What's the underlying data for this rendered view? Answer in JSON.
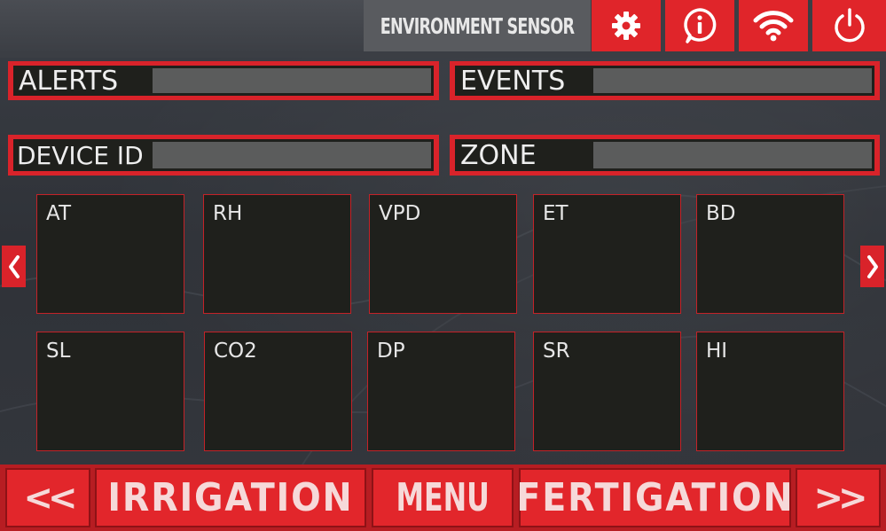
{
  "header": {
    "title": "ENVIRONMENT SENSOR",
    "buttons": [
      {
        "name": "settings",
        "icon": "gear-icon"
      },
      {
        "name": "info",
        "icon": "info-icon"
      },
      {
        "name": "wifi",
        "icon": "wifi-icon"
      },
      {
        "name": "power",
        "icon": "power-icon"
      }
    ]
  },
  "info": {
    "alerts_label": "ALERTS",
    "alerts_value": "",
    "events_label": "EVENTS",
    "events_value": "",
    "device_id_label": "DEVICE ID",
    "device_id_value": "",
    "zone_label": "ZONE",
    "zone_value": ""
  },
  "tiles": {
    "row1": [
      "AT",
      "RH",
      "VPD",
      "ET",
      "BD"
    ],
    "row2": [
      "SL",
      "CO2",
      "DP",
      "SR",
      "HI"
    ]
  },
  "pager": {
    "prev_icon": "chevron-left-icon",
    "next_icon": "chevron-right-icon"
  },
  "nav": {
    "prev": "<<",
    "irrigation": "IRRIGATION",
    "menu": "MENU",
    "fertigation": "FERTIGATION",
    "next": ">>"
  },
  "colors": {
    "accent_red": "#e0252a",
    "dark_panel": "#1f201c",
    "field_gray": "#5b5c5c",
    "background": "#34373d"
  }
}
